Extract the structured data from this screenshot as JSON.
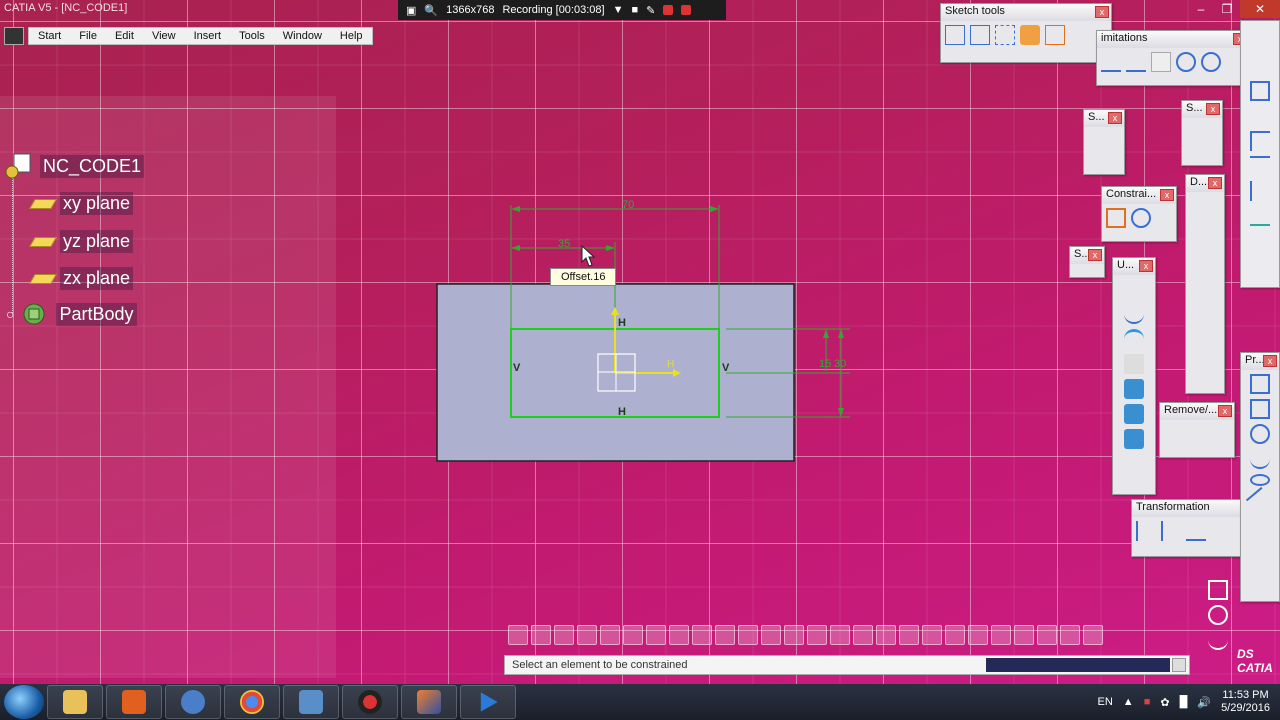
{
  "window": {
    "title": "CATIA V5 - [NC_CODE1]",
    "recording": {
      "resolution": "1366x768",
      "status": "Recording [00:03:08]"
    }
  },
  "menu": {
    "items": [
      "Start",
      "File",
      "Edit",
      "View",
      "Insert",
      "Tools",
      "Window",
      "Help"
    ]
  },
  "tree": {
    "root": "NC_CODE1",
    "children": [
      "xy plane",
      "yz plane",
      "zx plane",
      "PartBody"
    ]
  },
  "sketch": {
    "dimensions": {
      "overall_width": "70",
      "half_width": "35",
      "height_label": "30",
      "small_label": "15"
    },
    "constraint_letters": {
      "vertical": "V",
      "horizontal": "H"
    },
    "tooltip": "Offset.16",
    "colors": {
      "solid_fill": "#aeb0cf",
      "profile_green": "#19d219",
      "dimension_green": "#32a832",
      "axis_yellow": "#e8e020"
    }
  },
  "toolbars": {
    "sketch_tools": "Sketch tools",
    "limitations": "imitations",
    "constraint": "Constrai...",
    "transformation": "Transformation",
    "remove": "Remove/...",
    "small_s": "S...",
    "small_d": "D...",
    "small_u": "U...",
    "profile": "Pr..."
  },
  "status_bar": {
    "message": "Select an element to be constrained"
  },
  "taskbar": {
    "language": "EN",
    "time": "11:53 PM",
    "date": "5/29/2016"
  },
  "brand": "CATIA",
  "brand_mark": "DS"
}
